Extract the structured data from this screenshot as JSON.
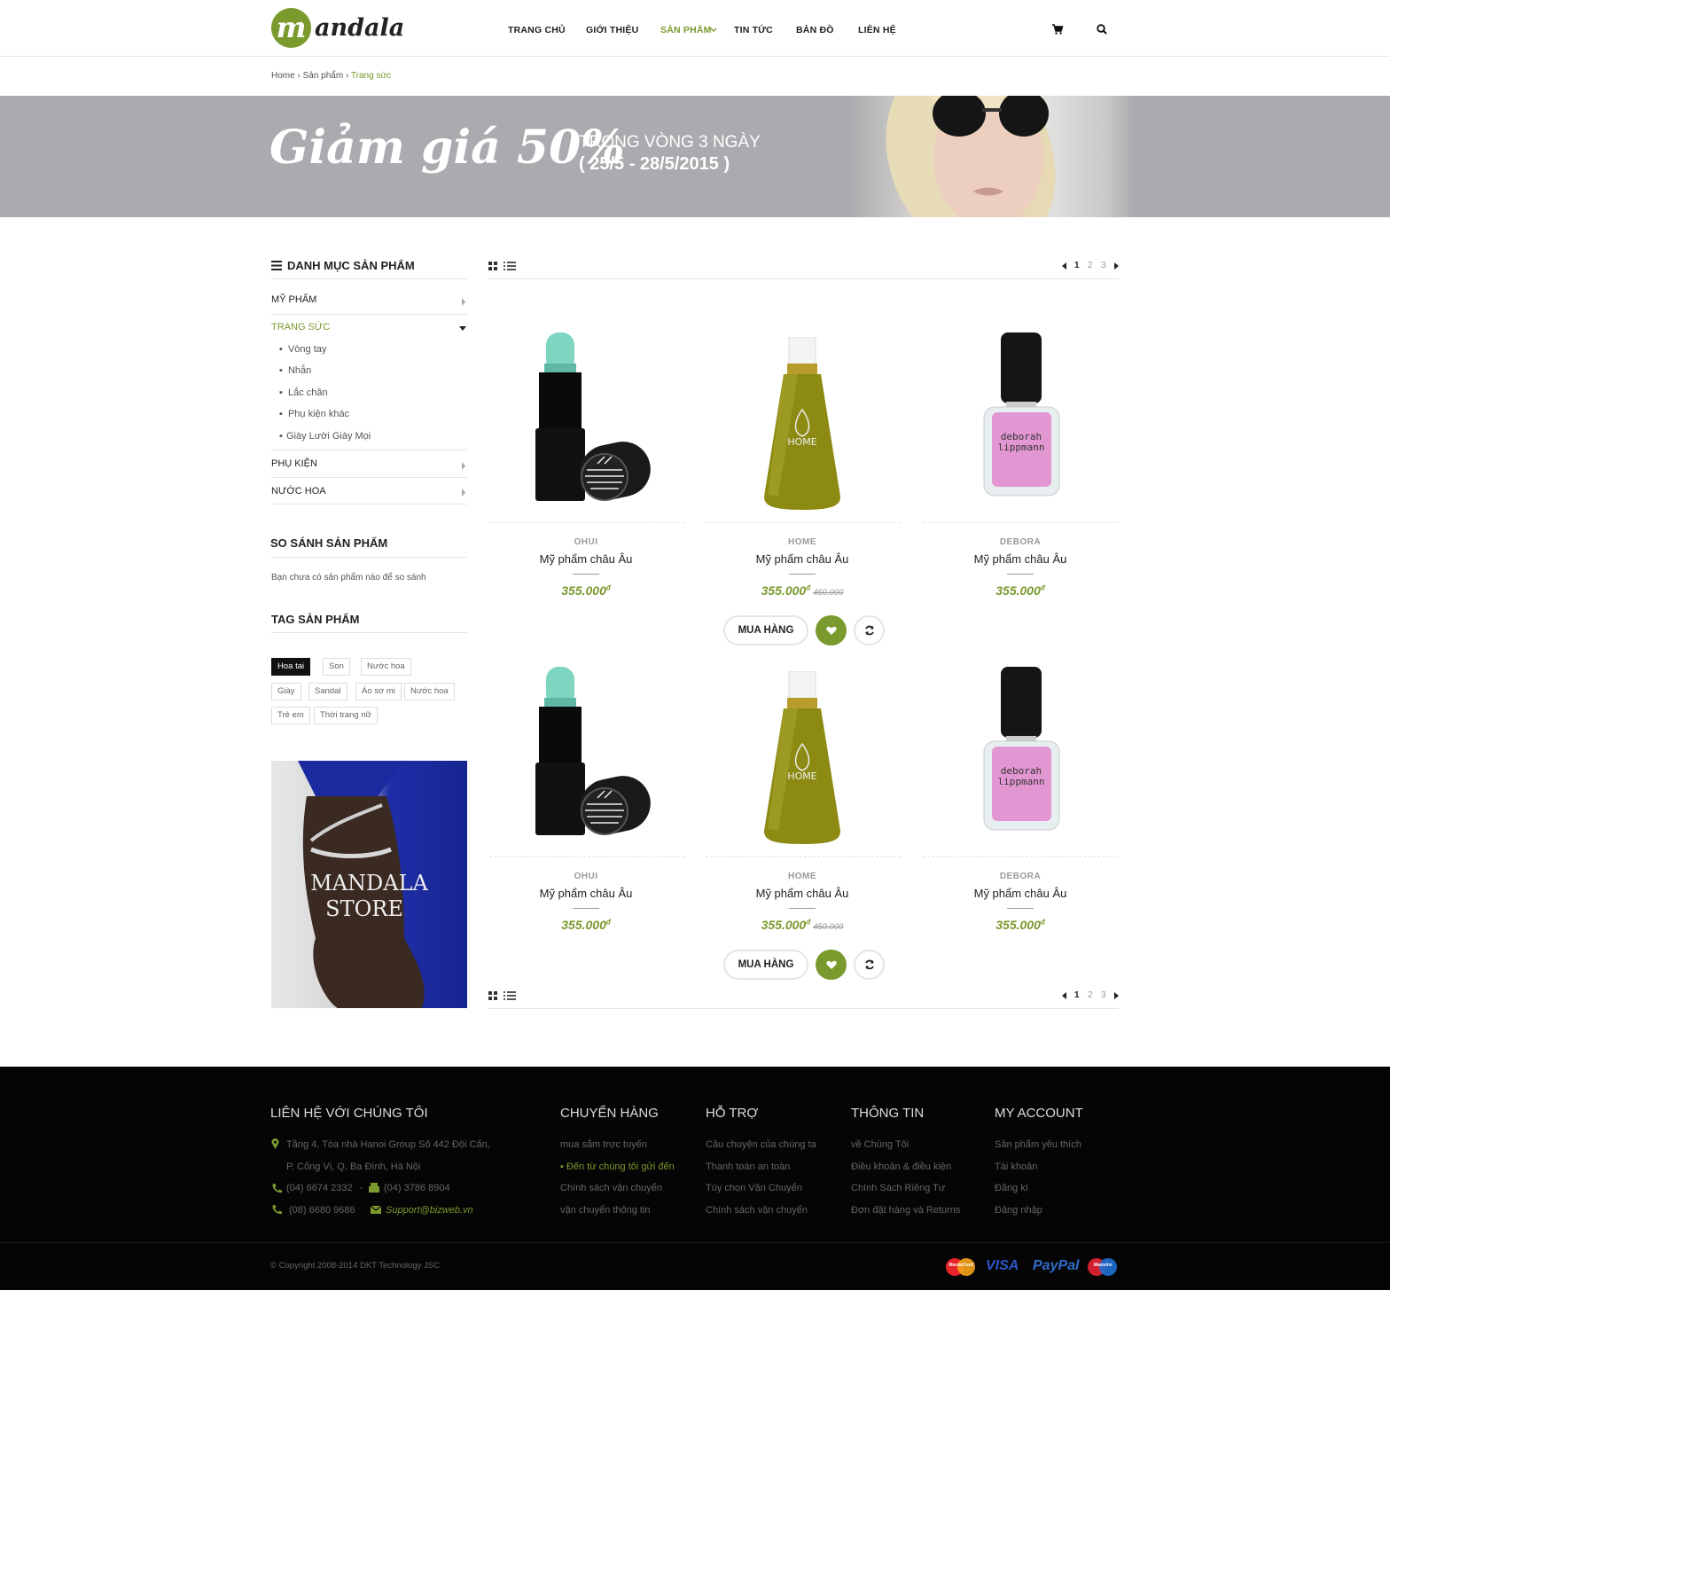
{
  "header": {
    "logo_letter": "m",
    "logo_text": "andala",
    "nav": [
      "TRANG CHỦ",
      "GIỚI THIỆU",
      "SẢN PHẨM",
      "TIN TỨC",
      "BẢN ĐỒ",
      "LIÊN HỆ"
    ],
    "active_nav": "SẢN PHẨM",
    "icons": [
      "cart-icon",
      "search-icon"
    ]
  },
  "breadcrumb": {
    "home": "Home",
    "sep": "›",
    "products": "Sản phẩm",
    "current": "Trang sức"
  },
  "banner": {
    "headline": "Giảm giá 50%",
    "line1": "TRONG VÒNG 3 NGÀY",
    "line2": "( 25/5 - 28/5/2015 )"
  },
  "sidebar": {
    "categories_title": "DANH MỤC SẢN PHẨM",
    "categories": [
      {
        "label": "MỸ PHẨM"
      },
      {
        "label": "TRANG SỨC",
        "expanded": true
      },
      {
        "label": "PHỤ KIỆN"
      },
      {
        "label": "NƯỚC HOA"
      }
    ],
    "subcategories": [
      "Vòng tay",
      "Nhẫn",
      "Lắc chân",
      "Phụ kiện khác",
      "Giày Lười Giày Mọi"
    ],
    "compare_title": "SO SÁNH SẢN PHẨM",
    "compare_text": "Bạn chưa có sản phẩm nào để so sánh",
    "tags_title": "TAG SẢN PHẨM",
    "tags": [
      "Hoa tai",
      "Son",
      "Nước hoa",
      "Giày",
      "Sandal",
      "Áo sơ mi",
      "Nước hoa",
      "Trẻ em",
      "Thời trang nữ"
    ],
    "active_tag": "Hoa tai",
    "promo": {
      "line1": "MANDALA",
      "line2": "STORE"
    }
  },
  "toolbar": {
    "pages": [
      "1",
      "2",
      "3"
    ],
    "current_page": "1"
  },
  "products": [
    {
      "brand": "OHUI",
      "name": "Mỹ phẩm châu Âu",
      "price": "355.000",
      "currency": "đ",
      "old_price": ""
    },
    {
      "brand": "HOME",
      "name": "Mỹ phẩm châu Âu",
      "price": "355.000",
      "currency": "đ",
      "old_price": "450.000"
    },
    {
      "brand": "DEBORA",
      "name": "Mỹ phẩm châu Âu",
      "price": "355.000",
      "currency": "đ",
      "old_price": ""
    },
    {
      "brand": "OHUI",
      "name": "Mỹ phẩm châu Âu",
      "price": "355.000",
      "currency": "đ",
      "old_price": ""
    },
    {
      "brand": "HOME",
      "name": "Mỹ phẩm châu Âu",
      "price": "355.000",
      "currency": "đ",
      "old_price": "450.000"
    },
    {
      "brand": "DEBORA",
      "name": "Mỹ phẩm châu Âu",
      "price": "355.000",
      "currency": "đ",
      "old_price": ""
    }
  ],
  "product_labels": {
    "home_bottle": "HOME",
    "polish_line1": "deborah",
    "polish_line2": "lippmann"
  },
  "actions": {
    "buy_label": "MUA HÀNG"
  },
  "footer": {
    "contact_title": "LIÊN HỆ VỚI CHÚNG TÔI",
    "address1": "Tầng 4, Tòa nhà Hanoi Group  Số 442 Đội Cấn,",
    "address2": "P. Cống Vị, Q. Ba Đình, Hà Nội",
    "phone1": "(04) 6674 2332",
    "dash": "-",
    "fax": "(04) 3786 8904",
    "phone2": "(08) 6680 9686",
    "email": "Support@bizweb.vn",
    "columns": [
      {
        "title": "CHUYỂN HÀNG",
        "links": [
          "mua sắm trực tuyến",
          "Đến từ chúng tôi gửi đến",
          "Chính sách vận chuyển",
          "vận chuyển thông tin"
        ]
      },
      {
        "title": "HỖ TRỢ",
        "links": [
          "Câu chuyện của chúng ta",
          "Thanh toán an toàn",
          "Tùy chọn Vận Chuyển",
          "Chính sách vận chuyển"
        ]
      },
      {
        "title": "THÔNG TIN",
        "links": [
          "về Chúng Tôi",
          "Điều khoản & điều kiện",
          "Chính Sách Riêng Tư",
          "Đơn đặt hàng và Returns"
        ]
      },
      {
        "title": "MY ACCOUNT",
        "links": [
          "Sản phẩm yêu thích",
          "Tài khoản",
          "Đăng kí",
          "Đăng nhập"
        ]
      }
    ],
    "copyright": "© Copyright 2008-2014 DKT Technology JSC",
    "payments": {
      "mastercard": "MasterCard",
      "visa": "VISA",
      "paypal": "PayPal",
      "maestro": "Maestro"
    }
  },
  "colors": {
    "accent": "#7a9a2e",
    "footer_bg": "#050505",
    "banner_bg": "#a9abae"
  }
}
